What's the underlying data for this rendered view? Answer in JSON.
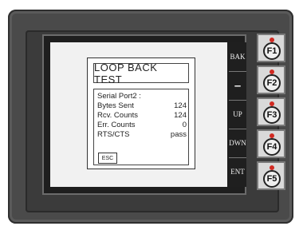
{
  "dialog": {
    "title": "LOOP BACK TEST",
    "section_label": "Serial Port2 :",
    "rows": [
      {
        "label": "Bytes Sent",
        "value": "124"
      },
      {
        "label": "Rcv. Counts",
        "value": "124"
      },
      {
        "label": "Err. Counts",
        "value": "0"
      },
      {
        "label": "RTS/CTS",
        "value": "pass"
      }
    ],
    "esc_label": "ESC"
  },
  "softkeys": [
    {
      "label": "BAK"
    },
    {
      "label": "–"
    },
    {
      "label": "UP"
    },
    {
      "label": "DWN"
    },
    {
      "label": "ENT"
    }
  ],
  "function_buttons": [
    {
      "label": "F1"
    },
    {
      "label": "F2"
    },
    {
      "label": "F3"
    },
    {
      "label": "F4"
    },
    {
      "label": "F5"
    }
  ]
}
